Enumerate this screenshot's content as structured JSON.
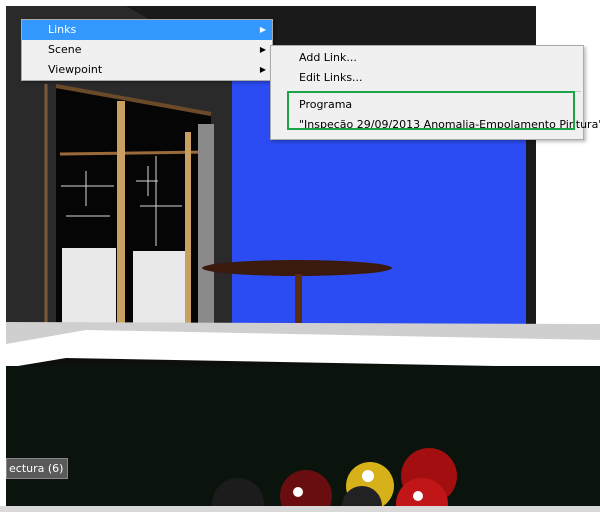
{
  "menu": {
    "items": [
      {
        "label": "Links",
        "active": true
      },
      {
        "label": "Scene",
        "active": false
      },
      {
        "label": "Viewpoint",
        "active": false
      }
    ]
  },
  "submenu": {
    "add_link": "Add Link...",
    "edit_links": "Edit Links...",
    "link_group": "Programa",
    "link_item": "\"Inspeção 29/09/2013 Anomalia-Empolamento Pintura\""
  },
  "viewport": {
    "object_label": "ectura (6)"
  },
  "colors": {
    "menu_highlight": "#3399ff",
    "annotation_box": "#1fa34a",
    "wall_blue": "#2b4cf2"
  }
}
